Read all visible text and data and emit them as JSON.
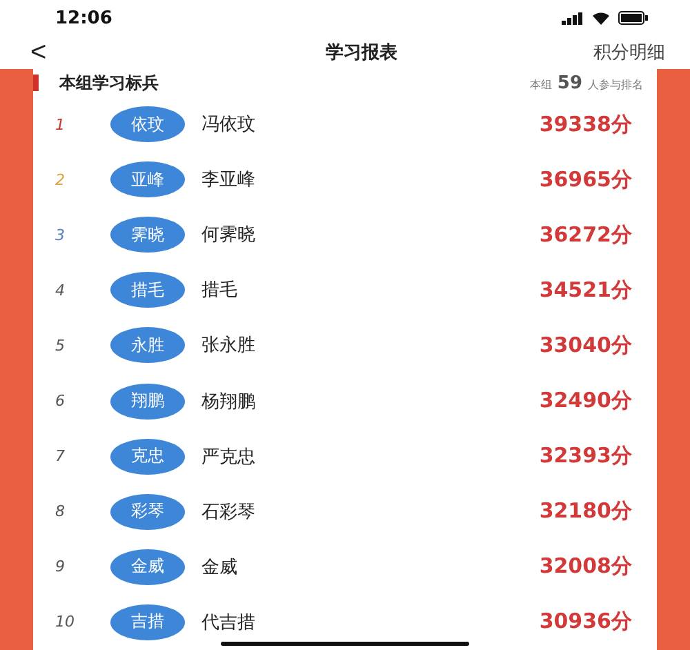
{
  "status_bar": {
    "time": "12:06"
  },
  "nav": {
    "back": "<",
    "title": "学习报表",
    "action": "积分明细"
  },
  "section": {
    "title": "本组学习标兵",
    "count_prefix": "本组",
    "count": "59",
    "count_suffix": "人参与排名"
  },
  "rows": [
    {
      "rank": "1",
      "color": "#c0392b",
      "avatar": "依玟",
      "name": "冯依玟",
      "score": "39338分"
    },
    {
      "rank": "2",
      "color": "#e0a040",
      "avatar": "亚峰",
      "name": "李亚峰",
      "score": "36965分"
    },
    {
      "rank": "3",
      "color": "#5a7fc0",
      "avatar": "霁晓",
      "name": "何霁晓",
      "score": "36272分"
    },
    {
      "rank": "4",
      "color": "#555555",
      "avatar": "措毛",
      "name": "措毛",
      "score": "34521分"
    },
    {
      "rank": "5",
      "color": "#555555",
      "avatar": "永胜",
      "name": "张永胜",
      "score": "33040分"
    },
    {
      "rank": "6",
      "color": "#555555",
      "avatar": "翔鹏",
      "name": "杨翔鹏",
      "score": "32490分"
    },
    {
      "rank": "7",
      "color": "#555555",
      "avatar": "克忠",
      "name": "严克忠",
      "score": "32393分"
    },
    {
      "rank": "8",
      "color": "#555555",
      "avatar": "彩琴",
      "name": "石彩琴",
      "score": "32180分"
    },
    {
      "rank": "9",
      "color": "#555555",
      "avatar": "金威",
      "name": "金威",
      "score": "32008分"
    },
    {
      "rank": "10",
      "color": "#555555",
      "avatar": "吉措",
      "name": "代吉措",
      "score": "30936分"
    }
  ]
}
